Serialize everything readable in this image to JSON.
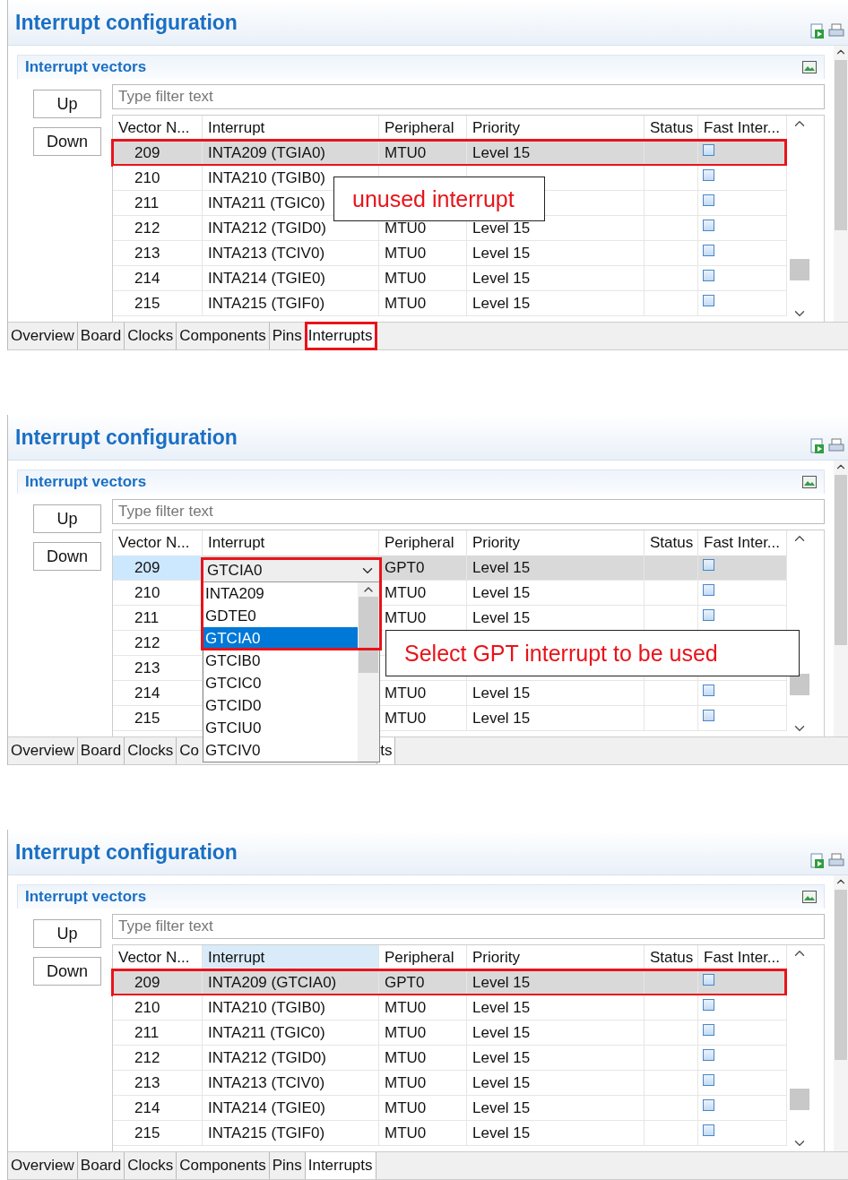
{
  "panels": [
    {
      "title": "Interrupt configuration",
      "section": "Interrupt vectors",
      "buttons": [
        "Up",
        "Down"
      ],
      "filter": {
        "placeholder": "Type filter text"
      },
      "columns": [
        {
          "label": "Vector N...",
          "sorted": false
        },
        {
          "label": "Interrupt",
          "sorted": false
        },
        {
          "label": "Peripheral",
          "sorted": false
        },
        {
          "label": "Priority",
          "sorted": false
        },
        {
          "label": "Status",
          "sorted": false
        },
        {
          "label": "Fast Inter...",
          "sorted": false
        }
      ],
      "rows": [
        {
          "vector": "209",
          "interrupt": "INTA209 (TGIA0)",
          "peripheral": "MTU0",
          "priority": "Level 15",
          "selected": true,
          "highlighted": true,
          "fast_interrupt": false
        },
        {
          "vector": "210",
          "interrupt": "INTA210 (TGIB0)",
          "selected": false,
          "highlighted": false,
          "fast_interrupt": false
        },
        {
          "vector": "211",
          "interrupt": "INTA211 (TGIC0)",
          "selected": false,
          "highlighted": false,
          "fast_interrupt": false
        },
        {
          "vector": "212",
          "interrupt": "INTA212 (TGID0)",
          "peripheral": "MTU0",
          "priority": "Level 15",
          "selected": false,
          "highlighted": false,
          "fast_interrupt": false
        },
        {
          "vector": "213",
          "interrupt": "INTA213 (TCIV0)",
          "peripheral": "MTU0",
          "priority": "Level 15",
          "selected": false,
          "highlighted": false,
          "fast_interrupt": false
        },
        {
          "vector": "214",
          "interrupt": "INTA214 (TGIE0)",
          "peripheral": "MTU0",
          "priority": "Level 15",
          "selected": false,
          "highlighted": false,
          "fast_interrupt": false
        },
        {
          "vector": "215",
          "interrupt": "INTA215 (TGIF0)",
          "peripheral": "MTU0",
          "priority": "Level 15",
          "selected": false,
          "highlighted": false,
          "fast_interrupt": false
        }
      ],
      "callout": "unused interrupt",
      "tabs": [
        {
          "label": "Overview",
          "selected": false,
          "highlighted": false
        },
        {
          "label": "Board",
          "selected": false,
          "highlighted": false
        },
        {
          "label": "Clocks",
          "selected": false,
          "highlighted": false
        },
        {
          "label": "Components",
          "selected": false,
          "highlighted": false
        },
        {
          "label": "Pins",
          "selected": false,
          "highlighted": false
        },
        {
          "label": "Interrupts",
          "selected": true,
          "highlighted": true
        }
      ]
    },
    {
      "title": "Interrupt configuration",
      "section": "Interrupt vectors",
      "buttons": [
        "Up",
        "Down"
      ],
      "filter": {
        "placeholder": "Type filter text"
      },
      "columns": [
        {
          "label": "Vector N...",
          "sorted": false
        },
        {
          "label": "Interrupt",
          "sorted": false
        },
        {
          "label": "Peripheral",
          "sorted": false
        },
        {
          "label": "Priority",
          "sorted": false
        },
        {
          "label": "Status",
          "sorted": false
        },
        {
          "label": "Fast Inter...",
          "sorted": false
        }
      ],
      "rows": [
        {
          "vector": "209",
          "peripheral": "GPT0",
          "priority": "Level 15",
          "selected": true,
          "editing": true,
          "highlighted": false,
          "fast_interrupt": false
        },
        {
          "vector": "210",
          "peripheral": "MTU0",
          "priority": "Level 15",
          "selected": false,
          "highlighted": false,
          "fast_interrupt": false
        },
        {
          "vector": "211",
          "peripheral": "MTU0",
          "priority": "Level 15",
          "selected": false,
          "highlighted": false,
          "fast_interrupt": false
        },
        {
          "vector": "212",
          "selected": false,
          "highlighted": false
        },
        {
          "vector": "213",
          "selected": false,
          "highlighted": false
        },
        {
          "vector": "214",
          "peripheral": "MTU0",
          "priority": "Level 15",
          "selected": false,
          "highlighted": false,
          "fast_interrupt": false
        },
        {
          "vector": "215",
          "peripheral": "MTU0",
          "priority": "Level 15",
          "selected": false,
          "highlighted": false,
          "fast_interrupt": false
        }
      ],
      "dropdown": {
        "value": "GTCIA0",
        "highlighted": true,
        "options": [
          {
            "label": "INTA209",
            "selected": false
          },
          {
            "label": "GDTE0",
            "selected": false
          },
          {
            "label": "GTCIA0",
            "selected": true
          },
          {
            "label": "GTCIB0",
            "selected": false
          },
          {
            "label": "GTCIC0",
            "selected": false
          },
          {
            "label": "GTCID0",
            "selected": false
          },
          {
            "label": "GTCIU0",
            "selected": false
          },
          {
            "label": "GTCIV0",
            "selected": false
          }
        ]
      },
      "callout": "Select GPT interrupt to be used",
      "tabs": [
        {
          "label": "Overview",
          "selected": false,
          "highlighted": false
        },
        {
          "label": "Board",
          "selected": false,
          "highlighted": false
        },
        {
          "label": "Clocks",
          "selected": false,
          "highlighted": false
        },
        {
          "label": "Co",
          "kind": "cut_right",
          "selected": false,
          "highlighted": false
        },
        {
          "label": "ts",
          "kind": "cut_left",
          "selected": true,
          "highlighted": false
        }
      ]
    },
    {
      "title": "Interrupt configuration",
      "section": "Interrupt vectors",
      "buttons": [
        "Up",
        "Down"
      ],
      "filter": {
        "placeholder": "Type filter text"
      },
      "columns": [
        {
          "label": "Vector N...",
          "sorted": false
        },
        {
          "label": "Interrupt",
          "sorted": true
        },
        {
          "label": "Peripheral",
          "sorted": false
        },
        {
          "label": "Priority",
          "sorted": false
        },
        {
          "label": "Status",
          "sorted": false
        },
        {
          "label": "Fast Inter...",
          "sorted": false
        }
      ],
      "rows": [
        {
          "vector": "209",
          "interrupt": "INTA209 (GTCIA0)",
          "peripheral": "GPT0",
          "priority": "Level 15",
          "selected": true,
          "highlighted": true,
          "fast_interrupt": false
        },
        {
          "vector": "210",
          "interrupt": "INTA210 (TGIB0)",
          "peripheral": "MTU0",
          "priority": "Level 15",
          "selected": false,
          "highlighted": false,
          "fast_interrupt": false
        },
        {
          "vector": "211",
          "interrupt": "INTA211 (TGIC0)",
          "peripheral": "MTU0",
          "priority": "Level 15",
          "selected": false,
          "highlighted": false,
          "fast_interrupt": false
        },
        {
          "vector": "212",
          "interrupt": "INTA212 (TGID0)",
          "peripheral": "MTU0",
          "priority": "Level 15",
          "selected": false,
          "highlighted": false,
          "fast_interrupt": false
        },
        {
          "vector": "213",
          "interrupt": "INTA213 (TCIV0)",
          "peripheral": "MTU0",
          "priority": "Level 15",
          "selected": false,
          "highlighted": false,
          "fast_interrupt": false
        },
        {
          "vector": "214",
          "interrupt": "INTA214 (TGIE0)",
          "peripheral": "MTU0",
          "priority": "Level 15",
          "selected": false,
          "highlighted": false,
          "fast_interrupt": false
        },
        {
          "vector": "215",
          "interrupt": "INTA215 (TGIF0)",
          "peripheral": "MTU0",
          "priority": "Level 15",
          "selected": false,
          "highlighted": false,
          "fast_interrupt": false
        }
      ],
      "tabs": [
        {
          "label": "Overview",
          "selected": false,
          "highlighted": false
        },
        {
          "label": "Board",
          "selected": false,
          "highlighted": false
        },
        {
          "label": "Clocks",
          "selected": false,
          "highlighted": false
        },
        {
          "label": "Components",
          "selected": false,
          "highlighted": false
        },
        {
          "label": "Pins",
          "selected": false,
          "highlighted": false
        },
        {
          "label": "Interrupts",
          "selected": true,
          "highlighted": false
        }
      ]
    }
  ]
}
